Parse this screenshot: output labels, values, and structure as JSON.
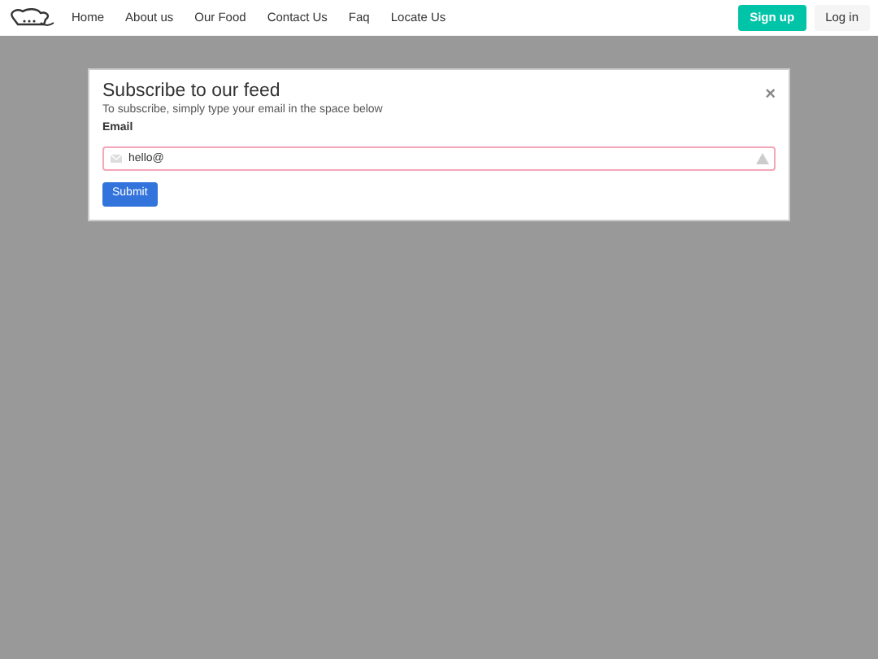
{
  "nav": {
    "links": [
      "Home",
      "About us",
      "Our Food",
      "Contact Us",
      "Faq",
      "Locate Us"
    ],
    "signup": "Sign up",
    "login": "Log in"
  },
  "modal": {
    "title": "Subscribe to our feed",
    "subtitle": "To subscribe, simply type your email in the space below",
    "close": "×",
    "field": {
      "label": "Email",
      "value": "hello@",
      "invalid": true
    },
    "submit": "Submit"
  }
}
